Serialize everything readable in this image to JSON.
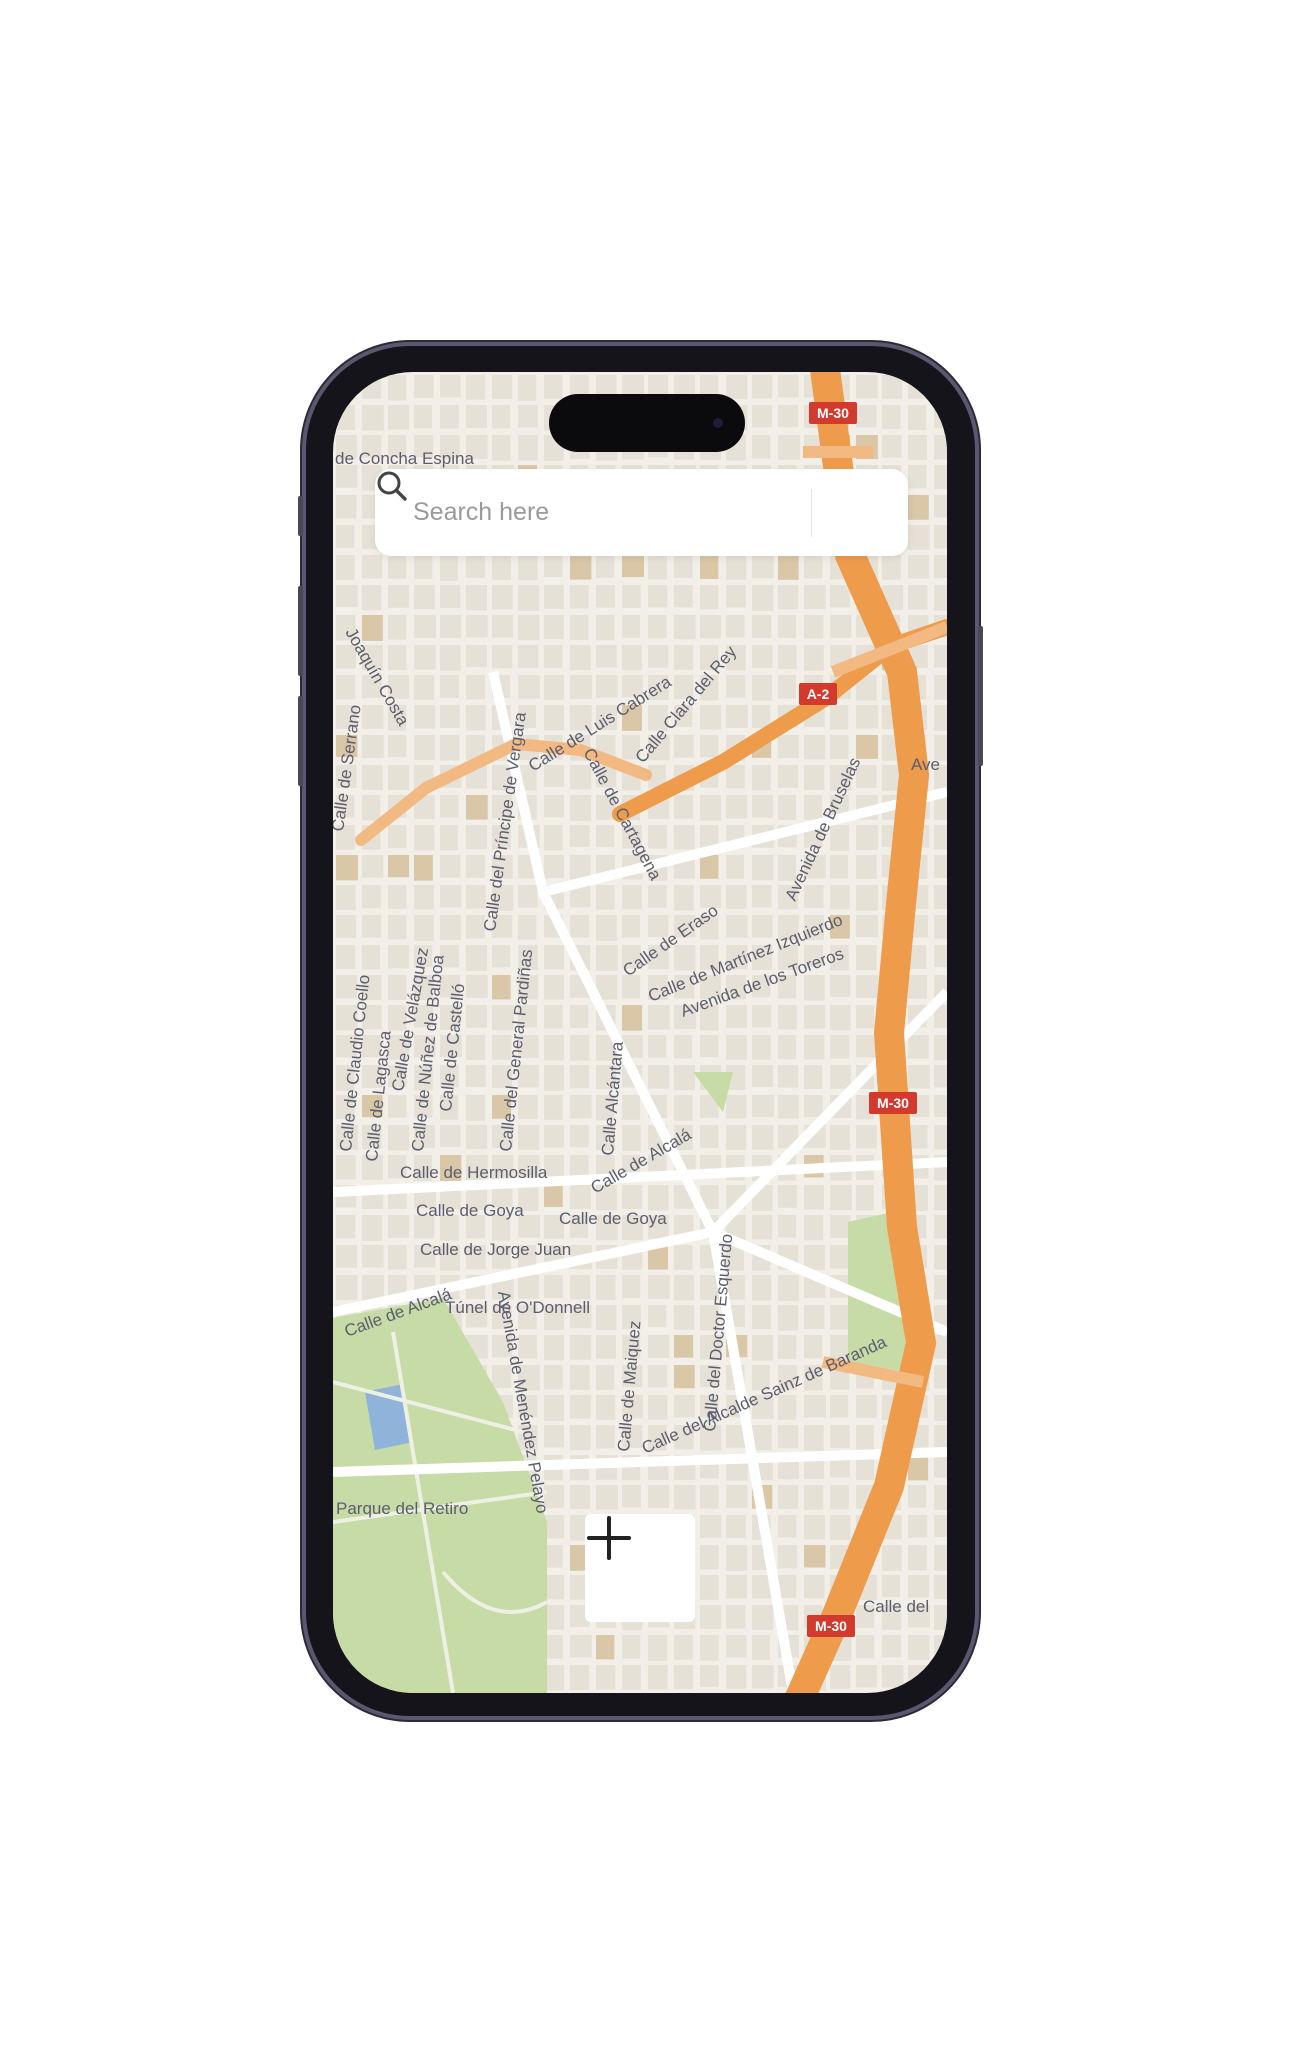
{
  "search": {
    "placeholder": "Search here",
    "value": "",
    "icon": "search-icon"
  },
  "zoom_in": {
    "label": "+",
    "icon": "plus-icon"
  },
  "map": {
    "colors": {
      "background": "#f2efe9",
      "block": "#e6e1d6",
      "park": "#c6dba6",
      "highway": "#ee9b4c",
      "highway_light": "#f3b982",
      "label": "#5b5e6e",
      "shield": "#d23a2e"
    },
    "shields": [
      "M-30",
      "A-2",
      "M-30",
      "M-30"
    ],
    "labels": [
      "de Concha Espina",
      "Calle de Luis Cabrera",
      "Calle Clara del Rey",
      "Calle de Cartagena",
      "Calle de Eraso",
      "Calle de Martínez Izquierdo",
      "Avenida de los Toreros",
      "Avenida de Bruselas",
      "Calle del Príncipe de Vergara",
      "Calle de Velázquez",
      "Calle de Núñez de Balboa",
      "Calle de Castelló",
      "Calle del General Pardiñas",
      "Calle de Claudio Coello",
      "Calle de Lagasca",
      "Calle de Serrano",
      "Calle de Hermosilla",
      "Calle de Goya",
      "Calle de Goya",
      "Calle de Jorge Juan",
      "Calle de Alcalá",
      "Túnel de O'Donnell",
      "Calle de Alcalá",
      "Calle Alcántara",
      "Calle del Doctor Esquerdo",
      "Calle de Maiquez",
      "Calle del Alcalde Sainz de Baranda",
      "Avenida de Menéndez Pelayo",
      "Parque del Retiro",
      "Calle del",
      "Ave",
      "Joaquín Costa"
    ]
  }
}
